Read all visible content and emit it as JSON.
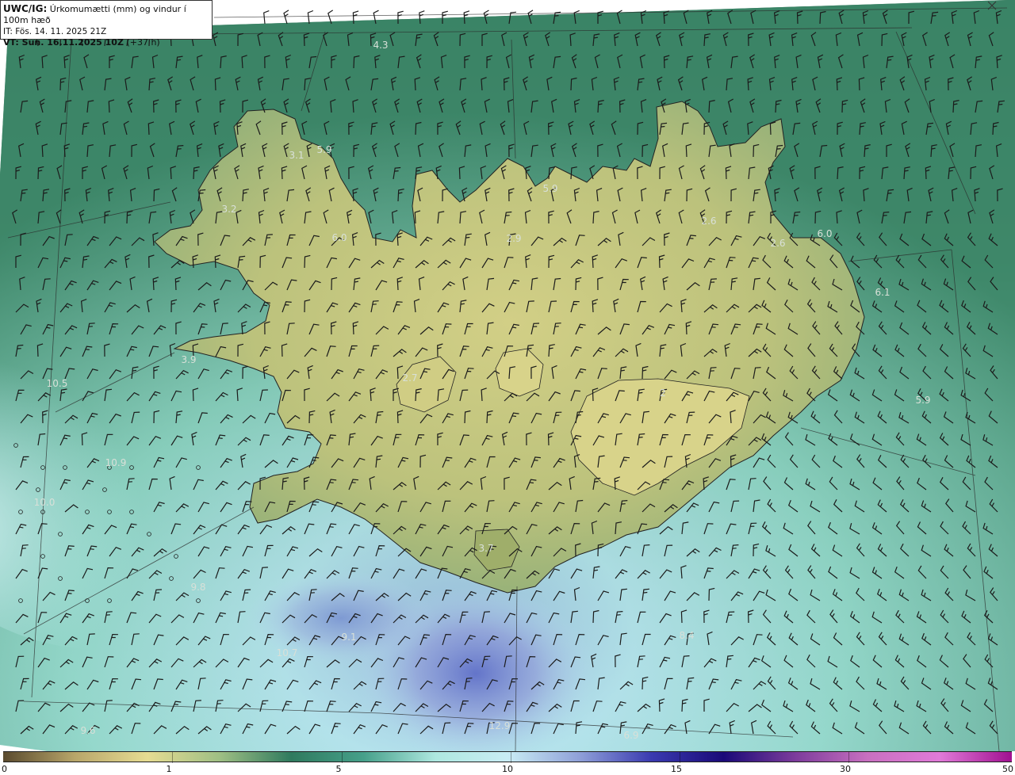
{
  "header": {
    "model": "UWC/IG:",
    "title": "Úrkomumætti (mm) og vindur í 100m hæð",
    "init_time": "IT: Fös. 14. 11. 2025 21Z",
    "valid_prefix": "VT: Sun. 16.11.2025 10Z",
    "valid_suffix": "(+37 h)"
  },
  "colorbar": {
    "ticks": [
      "0",
      "1",
      "5",
      "10",
      "15",
      "30",
      "50"
    ],
    "stops": [
      "#5a4a2e",
      "#b8a66a",
      "#e6dc92",
      "#9fbf84",
      "#2f7a5e",
      "#46a08a",
      "#aee8e0",
      "#c9ecf4",
      "#8fa0d8",
      "#3a3ab0",
      "#1a0a78",
      "#7d3c9c",
      "#c870c0",
      "#e07ad8",
      "#a01090"
    ]
  },
  "map": {
    "land_color": "#c5c680",
    "sea_colors": [
      "#2c6f52",
      "#4d9a7a",
      "#8fd4c4",
      "#c4eef0",
      "#8e96d6"
    ],
    "point_values": [
      {
        "label": "4.3"
      },
      {
        "label": "5.9"
      },
      {
        "label": "3.1"
      },
      {
        "label": "3.2"
      },
      {
        "label": "6.0"
      },
      {
        "label": "5.9"
      },
      {
        "label": "2.9"
      },
      {
        "label": "2.6"
      },
      {
        "label": "2.6"
      },
      {
        "label": "6.0"
      },
      {
        "label": "6.1"
      },
      {
        "label": "3.9"
      },
      {
        "label": "10.5"
      },
      {
        "label": "2.7"
      },
      {
        "label": "2"
      },
      {
        "label": "5.9"
      },
      {
        "label": "10.9"
      },
      {
        "label": "10.0"
      },
      {
        "label": "3.7"
      },
      {
        "label": "9.8"
      },
      {
        "label": "10.7"
      },
      {
        "label": "9.1"
      },
      {
        "label": "8.4"
      },
      {
        "label": "9.6"
      },
      {
        "label": "12.9"
      },
      {
        "label": "6.9"
      }
    ]
  }
}
